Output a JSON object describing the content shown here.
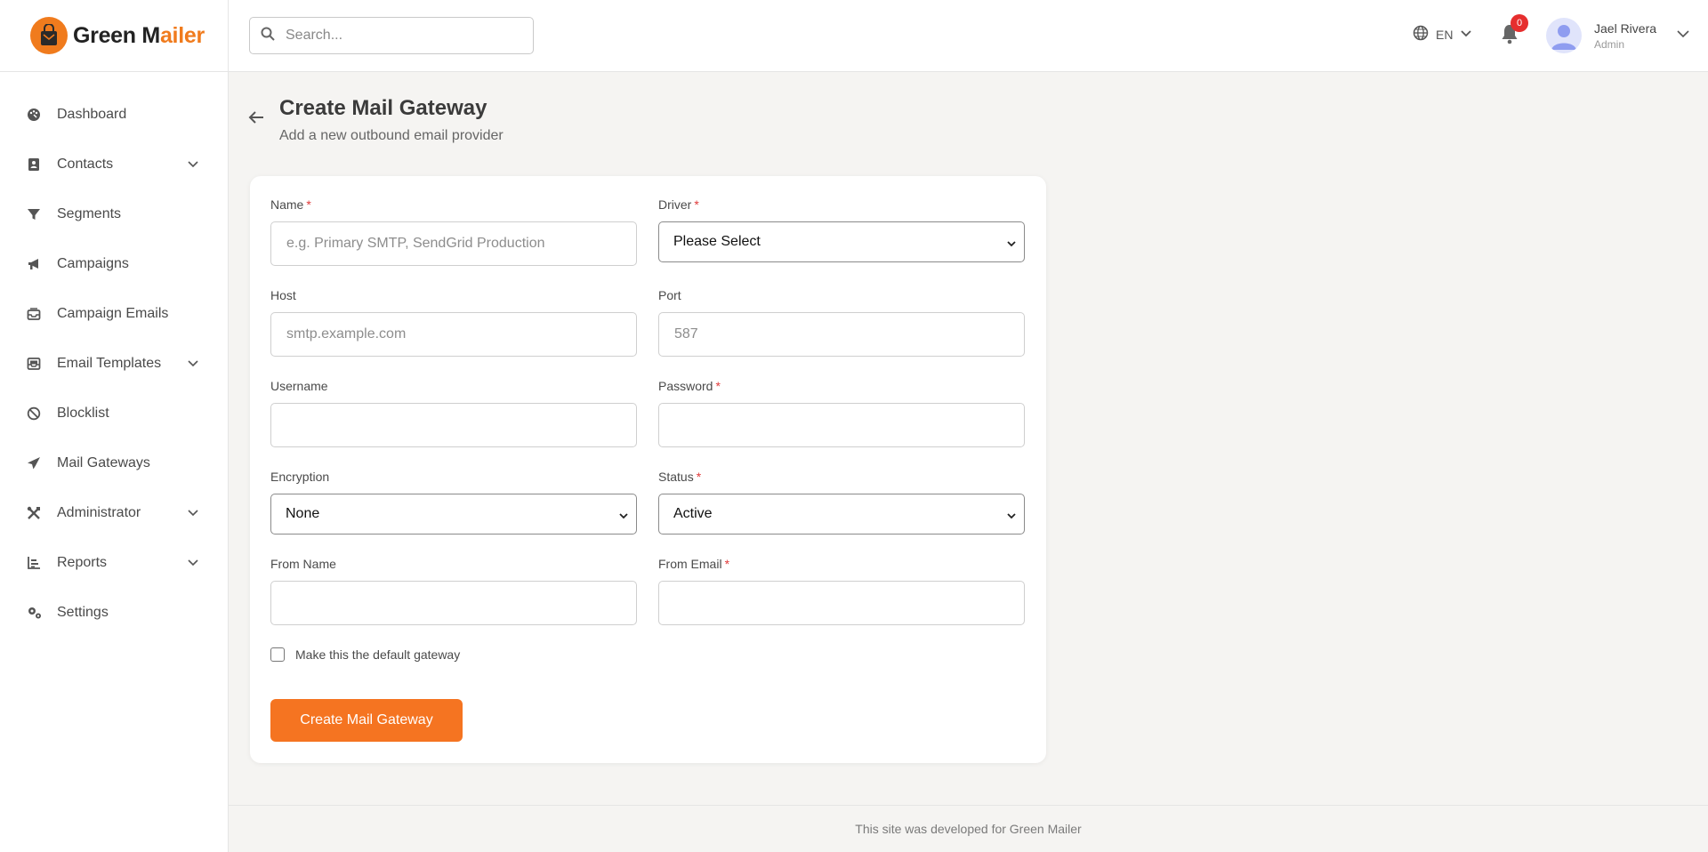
{
  "brand": {
    "name_part1": "Green M",
    "name_part2": "a",
    "name_part3": "iler",
    "accent_color": "#f07b1d"
  },
  "header": {
    "search_placeholder": "Search...",
    "language": "EN",
    "notifications_count": "0",
    "user_name": "Jael Rivera",
    "user_role": "Admin"
  },
  "sidebar": {
    "items": [
      {
        "label": "Dashboard",
        "icon": "palette-icon",
        "has_children": false
      },
      {
        "label": "Contacts",
        "icon": "address-book-icon",
        "has_children": true
      },
      {
        "label": "Segments",
        "icon": "funnel-icon",
        "has_children": false
      },
      {
        "label": "Campaigns",
        "icon": "megaphone-icon",
        "has_children": false
      },
      {
        "label": "Campaign Emails",
        "icon": "inbox-icon",
        "has_children": false
      },
      {
        "label": "Email Templates",
        "icon": "envelope-open-icon",
        "has_children": true
      },
      {
        "label": "Blocklist",
        "icon": "ban-icon",
        "has_children": false
      },
      {
        "label": "Mail Gateways",
        "icon": "paper-plane-icon",
        "has_children": false
      },
      {
        "label": "Administrator",
        "icon": "tools-icon",
        "has_children": true
      },
      {
        "label": "Reports",
        "icon": "bar-chart-icon",
        "has_children": true
      },
      {
        "label": "Settings",
        "icon": "gears-icon",
        "has_children": false
      }
    ]
  },
  "page": {
    "title": "Create Mail Gateway",
    "subtitle": "Add a new outbound email provider"
  },
  "form": {
    "name": {
      "label": "Name",
      "required_mark": "*",
      "placeholder": "e.g. Primary SMTP, SendGrid Production",
      "value": ""
    },
    "driver": {
      "label": "Driver",
      "required_mark": "*",
      "selected": "Please Select"
    },
    "host": {
      "label": "Host",
      "placeholder": "smtp.example.com",
      "value": ""
    },
    "port": {
      "label": "Port",
      "placeholder": "587",
      "value": ""
    },
    "username": {
      "label": "Username",
      "value": ""
    },
    "password": {
      "label": "Password",
      "required_mark": "*",
      "value": ""
    },
    "encryption": {
      "label": "Encryption",
      "selected": "None"
    },
    "status": {
      "label": "Status",
      "required_mark": "*",
      "selected": "Active"
    },
    "from_name": {
      "label": "From Name",
      "value": ""
    },
    "from_email": {
      "label": "From Email",
      "required_mark": "*",
      "value": ""
    },
    "default_checkbox": {
      "label": "Make this the default gateway",
      "checked": false
    },
    "submit_label": "Create Mail Gateway"
  },
  "footer": {
    "text": "This site was developed for Green Mailer"
  },
  "colors": {
    "primary_button": "#f57421",
    "badge": "#e62e2e",
    "background": "#f5f4f2"
  }
}
